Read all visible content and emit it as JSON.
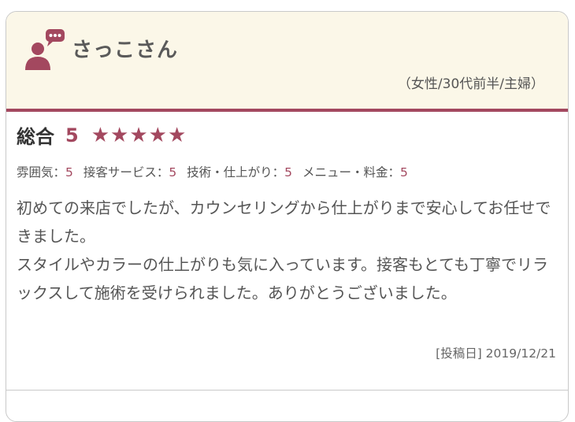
{
  "reviewer": {
    "name": "さっこさん",
    "profile": "（女性/30代前半/主婦）"
  },
  "colors": {
    "accent": "#a3485f",
    "header_bg": "#fbf7e8",
    "border": "#c9c9c9"
  },
  "rating": {
    "overall_label": "総合",
    "overall_score": "5",
    "stars": 5,
    "sub": [
      {
        "label": "雰囲気：",
        "value": "5"
      },
      {
        "label": "接客サービス：",
        "value": "5"
      },
      {
        "label": "技術・仕上がり：",
        "value": "5"
      },
      {
        "label": "メニュー・料金：",
        "value": "5"
      }
    ]
  },
  "comment": "初めての来店でしたが、カウンセリングから仕上がりまで安心してお任せできました。\nスタイルやカラーの仕上がりも気に入っています。接客もとても丁寧でリラックスして施術を受けられました。ありがとうございました。",
  "post_date": "[投稿日] 2019/12/21",
  "icons": {
    "avatar": "user-speech-icon",
    "star": "star-icon"
  }
}
